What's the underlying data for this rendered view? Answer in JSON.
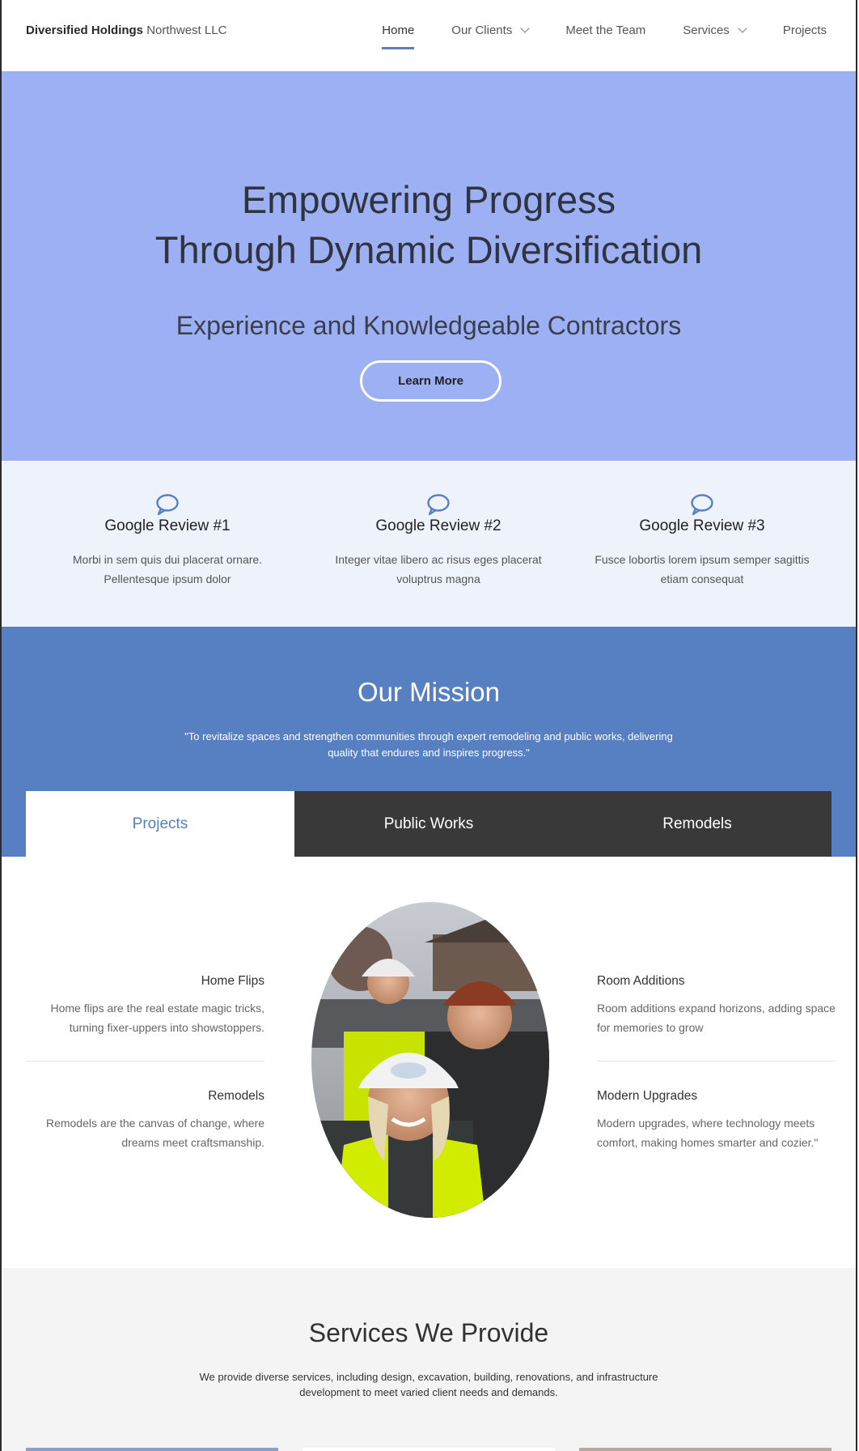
{
  "nav": {
    "brand_bold": "Diversified Holdings",
    "brand_light": "Northwest LLC",
    "items": [
      {
        "label": "Home",
        "active": true,
        "dropdown": false
      },
      {
        "label": "Our Clients",
        "active": false,
        "dropdown": true
      },
      {
        "label": "Meet the Team",
        "active": false,
        "dropdown": false
      },
      {
        "label": "Services",
        "active": false,
        "dropdown": true
      },
      {
        "label": "Projects",
        "active": false,
        "dropdown": false
      }
    ]
  },
  "hero": {
    "title_line1": "Empowering Progress",
    "title_line2": "Through Dynamic Diversification",
    "subtitle": "Experience and Knowledgeable Contractors",
    "button": "Learn More",
    "bg_color": "#9db0f3"
  },
  "reviews": [
    {
      "title": "Google Review #1",
      "line1": "Morbi in sem quis dui placerat ornare.",
      "line2": "Pellentesque ipsum dolor",
      "icon": "chat-bubble-icon"
    },
    {
      "title": "Google Review #2",
      "line1": "Integer vitae libero ac risus eges placerat",
      "line2": "voluptrus magna",
      "icon": "chat-bubble-icon"
    },
    {
      "title": "Google Review #3",
      "line1": "Fusce lobortis lorem ipsum semper sagittis",
      "line2": "etiam consequat",
      "icon": "chat-bubble-icon"
    }
  ],
  "mission": {
    "title": "Our Mission",
    "quote_line1": "\"To revitalize spaces and strengthen communities through expert remodeling and public works, delivering",
    "quote_line2": "quality that endures and inspires progress.\"",
    "bg_color": "#5680c1"
  },
  "tabs": [
    {
      "label": "Projects",
      "active": true
    },
    {
      "label": "Public Works",
      "active": false
    },
    {
      "label": "Remodels",
      "active": false
    }
  ],
  "features": {
    "left": [
      {
        "title": "Home Flips",
        "line1": "Home flips are the real estate magic tricks,",
        "line2": "turning fixer-uppers into showstoppers."
      },
      {
        "title": "Remodels",
        "line1": "Remodels are the canvas of change, where",
        "line2": "dreams meet craftsmanship."
      }
    ],
    "right": [
      {
        "title": "Room Additions",
        "line1": "Room additions expand horizons, adding space",
        "line2": "for memories to grow"
      },
      {
        "title": "Modern Upgrades",
        "line1": "Modern upgrades, where technology meets",
        "line2": "comfort, making homes smarter and cozier.\""
      }
    ]
  },
  "services": {
    "title": "Services We Provide",
    "line1": "We provide diverse services, including design, excavation, building, renovations, and infrastructure",
    "line2": "development to meet varied client needs and demands."
  }
}
